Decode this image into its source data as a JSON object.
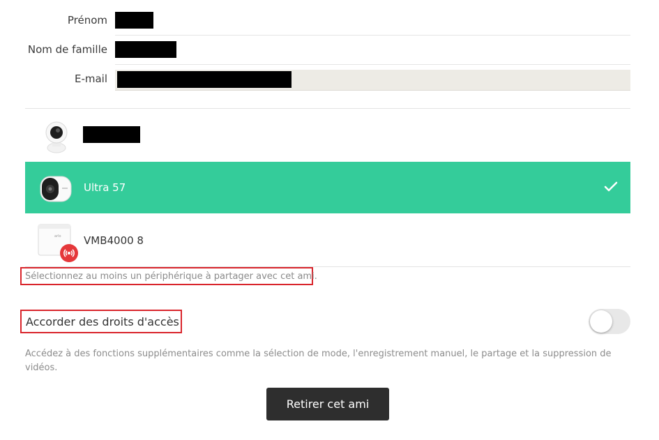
{
  "form": {
    "first_name_label": "Prénom",
    "last_name_label": "Nom de famille",
    "email_label": "E-mail"
  },
  "devices": [
    {
      "name": "",
      "icon": "indoor-camera-icon",
      "selected": false
    },
    {
      "name": "Ultra 57",
      "icon": "outdoor-camera-icon",
      "selected": true
    },
    {
      "name": "VMB4000 8",
      "icon": "base-station-icon",
      "selected": false
    }
  ],
  "hint": "Sélectionnez au moins un périphérique à partager avec cet ami.",
  "access": {
    "title": "Accorder des droits d'accès",
    "enabled": false,
    "description": "Accédez à des fonctions supplémentaires comme la sélection de mode, l'enregistrement manuel, le partage et la suppression de vidéos."
  },
  "remove_button": "Retirer cet ami",
  "colors": {
    "selected_green": "#34cc9a",
    "alert_red": "#d9242b",
    "button_dark": "#2e2e2e",
    "base_station_badge": "#e5383b"
  }
}
